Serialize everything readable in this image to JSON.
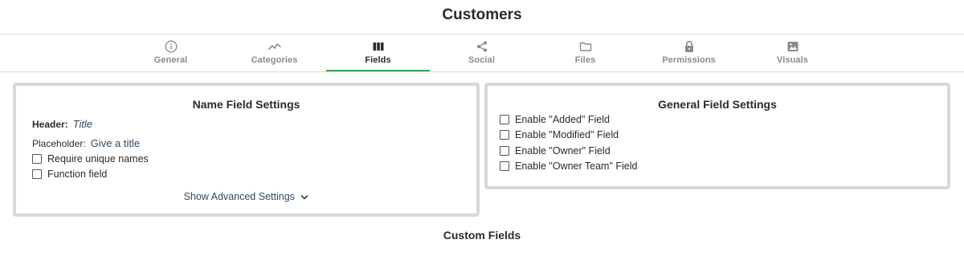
{
  "page": {
    "title": "Customers"
  },
  "tabs": [
    {
      "label": "General",
      "icon": "info-icon"
    },
    {
      "label": "Categories",
      "icon": "trend-line-icon"
    },
    {
      "label": "Fields",
      "icon": "columns-icon"
    },
    {
      "label": "Social",
      "icon": "share-icon"
    },
    {
      "label": "Files",
      "icon": "folder-icon"
    },
    {
      "label": "Permissions",
      "icon": "lock-icon"
    },
    {
      "label": "Visuals",
      "icon": "image-icon"
    }
  ],
  "active_tab": "Fields",
  "colors": {
    "active_tab_underline": "#3aa655",
    "link": "#2d4a63",
    "panel_border": "#d8d8d8"
  },
  "name_settings": {
    "heading": "Name Field Settings",
    "header_label": "Header:",
    "header_value": "Title",
    "placeholder_label": "Placeholder:",
    "placeholder_value": "Give a title",
    "require_unique": "Require unique names",
    "function_field": "Function field",
    "advanced_link": "Show Advanced Settings"
  },
  "general_settings": {
    "heading": "General Field Settings",
    "options": [
      "Enable \"Added\" Field",
      "Enable \"Modified\" Field",
      "Enable \"Owner\" Field",
      "Enable \"Owner Team\" Field"
    ]
  },
  "custom_fields": {
    "heading": "Custom Fields"
  }
}
